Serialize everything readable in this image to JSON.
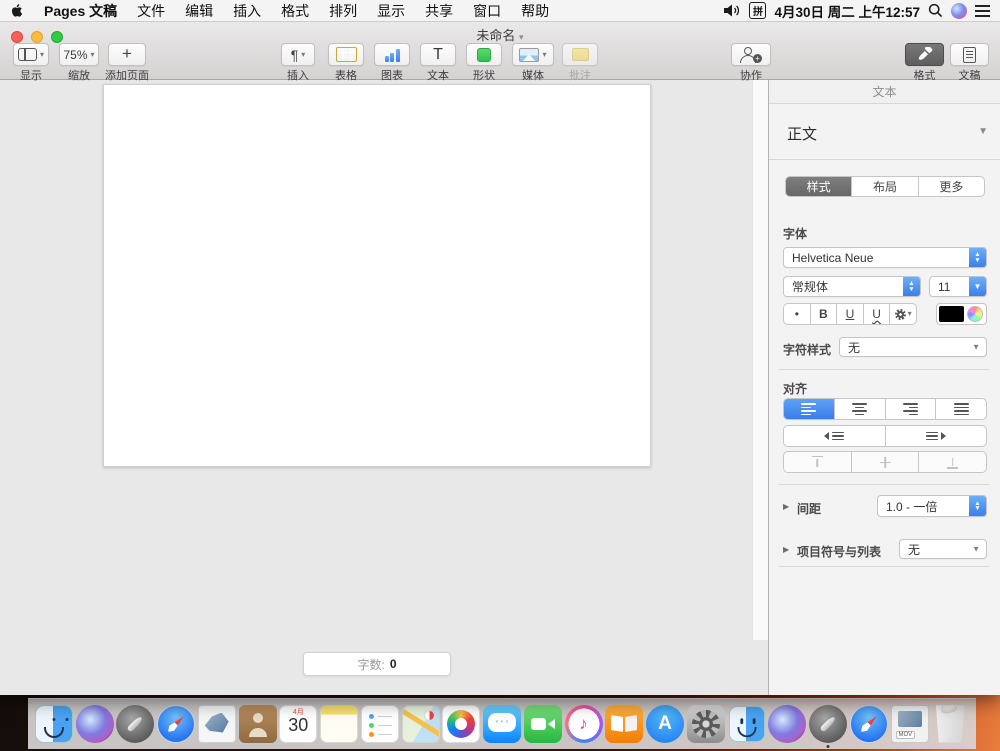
{
  "menu_bar": {
    "app_menu": "Pages 文稿",
    "menus": [
      "文件",
      "编辑",
      "插入",
      "格式",
      "排列",
      "显示",
      "共享",
      "窗口",
      "帮助"
    ],
    "input_method_label": "拼",
    "clock": "4月30日 周二 上午12:57"
  },
  "window": {
    "title": "未命名",
    "toolbar": {
      "view": "显示",
      "zoom_value": "75%",
      "zoom": "缩放",
      "add_page": "添加页面",
      "insert": "插入",
      "table": "表格",
      "chart": "图表",
      "text": "文本",
      "shape": "形状",
      "media": "媒体",
      "comment": "批注",
      "collaborate": "协作",
      "format": "格式",
      "document": "文稿"
    }
  },
  "canvas": {
    "word_count_label": "字数:",
    "word_count_value": "0"
  },
  "format_panel": {
    "title": "文本",
    "paragraph_style": "正文",
    "tabs": [
      "样式",
      "布局",
      "更多"
    ],
    "active_tab": "样式",
    "font": {
      "section_label": "字体",
      "family": "Helvetica Neue",
      "typeface": "常规体",
      "size": "11",
      "style_dot": "•",
      "bold": "B",
      "underline": "U",
      "underline_wavy": "U",
      "color": "#000000"
    },
    "character_style_label": "字符样式",
    "character_style_value": "无",
    "alignment_label": "对齐",
    "spacing_label": "间距",
    "spacing_value": "1.0 - 一倍",
    "bullets_label": "项目符号与列表",
    "bullets_value": "无"
  },
  "dock": {
    "items": [
      {
        "name": "finder",
        "running": true
      },
      {
        "name": "siri"
      },
      {
        "name": "launchpad"
      },
      {
        "name": "safari"
      },
      {
        "name": "mail"
      },
      {
        "name": "contacts"
      },
      {
        "name": "calendar",
        "texts": [
          {
            "cls": "cal-m",
            "value": "4月"
          },
          {
            "cls": "cal-d",
            "value": "30"
          }
        ]
      },
      {
        "name": "notes"
      },
      {
        "name": "reminders"
      },
      {
        "name": "maps"
      },
      {
        "name": "photos"
      },
      {
        "name": "messages"
      },
      {
        "name": "facetime"
      },
      {
        "name": "itunes"
      },
      {
        "name": "books"
      },
      {
        "name": "appstore"
      },
      {
        "name": "settings"
      },
      {
        "name": "finder-alt"
      },
      {
        "name": "siri-alt"
      },
      {
        "name": "launchpad-alt",
        "running": true
      },
      {
        "name": "safari-alt"
      },
      {
        "name": "mov-file",
        "texts": [
          {
            "cls": "mov-badge",
            "value": "MOV"
          }
        ]
      },
      {
        "name": "trash"
      }
    ]
  },
  "colors": {
    "accent_blue": "#3d7fe8",
    "selected_segment": "#6e6e6e",
    "arrow_red": "#e0261c"
  }
}
